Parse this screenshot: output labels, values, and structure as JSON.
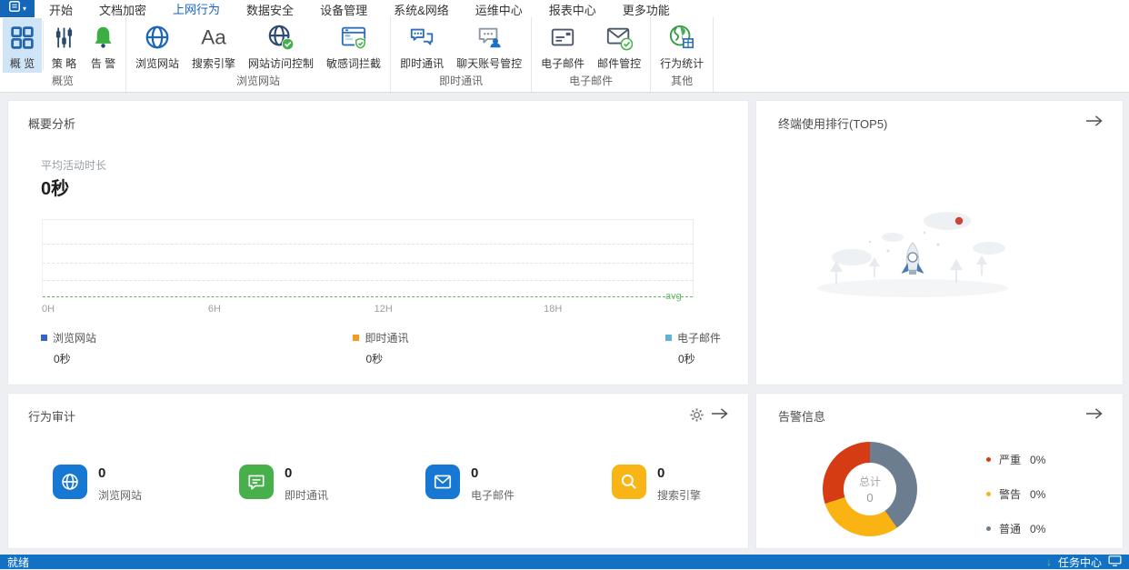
{
  "titlebar": {
    "app_menu_caret": "▾",
    "tabs": [
      {
        "label": "开始"
      },
      {
        "label": "文档加密"
      },
      {
        "label": "上网行为",
        "active": true
      },
      {
        "label": "数据安全"
      },
      {
        "label": "设备管理"
      },
      {
        "label": "系统&网络"
      },
      {
        "label": "运维中心"
      },
      {
        "label": "报表中心"
      },
      {
        "label": "更多功能"
      }
    ]
  },
  "ribbon": {
    "groups": [
      {
        "label": "概览",
        "buttons": [
          {
            "label": "概 览",
            "icon": "grid-icon",
            "active": true
          },
          {
            "label": "策 略",
            "icon": "sliders-icon"
          },
          {
            "label": "告 警",
            "icon": "bell-icon"
          }
        ]
      },
      {
        "label": "浏览网站",
        "buttons": [
          {
            "label": "浏览网站",
            "icon": "globe-icon"
          },
          {
            "label": "搜索引擎",
            "icon": "font-icon"
          },
          {
            "label": "网站访问控制",
            "icon": "globe-check-icon"
          },
          {
            "label": "敏感词拦截",
            "icon": "browser-shield-icon"
          }
        ]
      },
      {
        "label": "即时通讯",
        "buttons": [
          {
            "label": "即时通讯",
            "icon": "chat-icon"
          },
          {
            "label": "聊天账号管控",
            "icon": "chat-user-icon"
          }
        ]
      },
      {
        "label": "电子邮件",
        "buttons": [
          {
            "label": "电子邮件",
            "icon": "mail-icon"
          },
          {
            "label": "邮件管控",
            "icon": "mail-check-icon"
          }
        ]
      },
      {
        "label": "其他",
        "buttons": [
          {
            "label": "行为统计",
            "icon": "globe-stats-icon"
          }
        ]
      }
    ]
  },
  "summary_card": {
    "title": "概要分析",
    "metric_label": "平均活动时长",
    "metric_value": "0秒",
    "chart_data": {
      "type": "line",
      "x_ticks": [
        "0H",
        "6H",
        "12H",
        "18H"
      ],
      "x_range_hours": [
        0,
        24
      ],
      "avg_label": "avg",
      "avg_value": 0,
      "grid": "dashed-horizontal",
      "series": [
        {
          "name": "浏览网站",
          "color": "#3565c8",
          "values": [
            0
          ]
        },
        {
          "name": "即时通讯",
          "color": "#f59b22",
          "values": [
            0
          ]
        },
        {
          "name": "电子邮件",
          "color": "#5fb3d7",
          "values": [
            0
          ]
        }
      ]
    },
    "legend": [
      {
        "label": "浏览网站",
        "value": "0秒",
        "color": "#3565c8"
      },
      {
        "label": "即时通讯",
        "value": "0秒",
        "color": "#f59b22"
      },
      {
        "label": "电子邮件",
        "value": "0秒",
        "color": "#5fb3d7"
      }
    ]
  },
  "ranking_card": {
    "title": "终端使用排行(TOP5)"
  },
  "audit_card": {
    "title": "行为审计",
    "items": [
      {
        "value": "0",
        "label": "浏览网站",
        "color": "#1678d2",
        "icon": "globe-icon"
      },
      {
        "value": "0",
        "label": "即时通讯",
        "color": "#47b04b",
        "icon": "chat-icon"
      },
      {
        "value": "0",
        "label": "电子邮件",
        "color": "#1678d2",
        "icon": "mail-icon"
      },
      {
        "value": "0",
        "label": "搜索引擎",
        "color": "#f9b416",
        "icon": "search-icon"
      }
    ]
  },
  "alarm_card": {
    "title": "告警信息",
    "donut": {
      "center_label": "总计",
      "center_value": "0",
      "segments": [
        {
          "label": "严重",
          "pct": "0%",
          "color": "#d63c14",
          "from": 252,
          "to": 360
        },
        {
          "label": "警告",
          "pct": "0%",
          "color": "#f9b414",
          "from": 145,
          "to": 252
        },
        {
          "label": "普通",
          "pct": "0%",
          "color": "#6d7d90",
          "from": 0,
          "to": 145
        }
      ]
    }
  },
  "statusbar": {
    "ready": "就绪",
    "task_center": "任务中心"
  },
  "colors": {
    "accent": "#1467b8",
    "active_tab": "#1565bf",
    "statusbar_bg": "#1371c3",
    "page_bg": "#edeff3",
    "avg_line": "#5cb768",
    "ribbon_highlight": "#cfe4f6"
  }
}
